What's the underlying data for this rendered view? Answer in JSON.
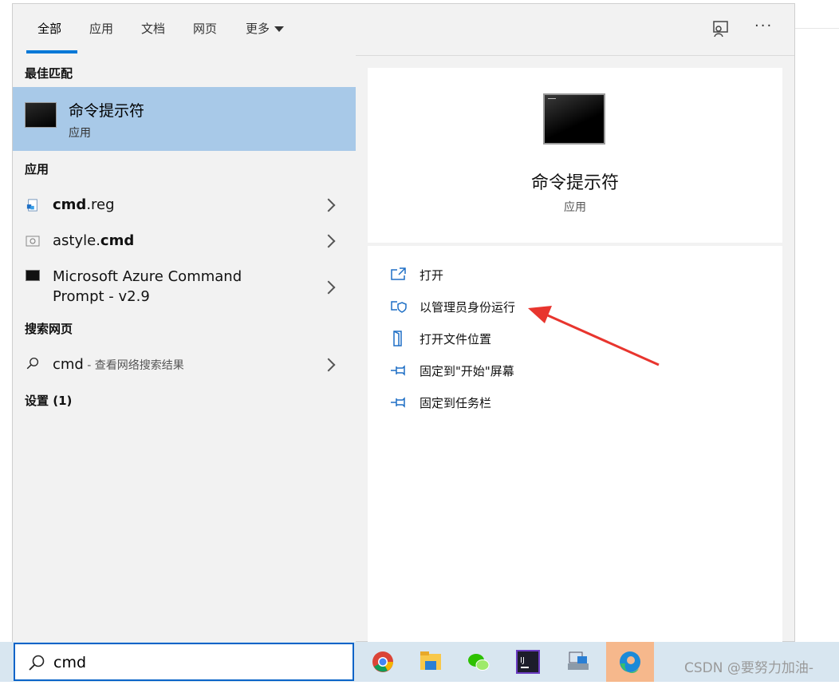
{
  "tabs": [
    {
      "label": "全部",
      "active": true
    },
    {
      "label": "应用"
    },
    {
      "label": "文档"
    },
    {
      "label": "网页"
    },
    {
      "label": "更多"
    }
  ],
  "toolbar_icons": [
    "feedback-icon",
    "more-options-icon"
  ],
  "more_dots": "···",
  "best_match": {
    "section": "最佳匹配",
    "title": "命令提示符",
    "subtitle": "应用",
    "icon": "command-prompt-icon"
  },
  "apps": {
    "section": "应用",
    "items": [
      {
        "bold": "cmd",
        "rest": ".reg",
        "icon": "registry-file-icon"
      },
      {
        "pre": "astyle.",
        "bold": "cmd",
        "icon": "cmd-file-icon"
      },
      {
        "line1": "Microsoft Azure Command",
        "line2": "Prompt - v2.9",
        "icon": "terminal-icon"
      }
    ]
  },
  "web": {
    "section": "搜索网页",
    "query": "cmd",
    "hint": " - 查看网络搜索结果",
    "icon": "search-icon"
  },
  "settings": {
    "section": "设置 (1)"
  },
  "detail": {
    "title": "命令提示符",
    "subtitle": "应用",
    "actions": [
      {
        "label": "打开",
        "icon": "open-icon"
      },
      {
        "label": "以管理员身份运行",
        "icon": "shield-icon"
      },
      {
        "label": "打开文件位置",
        "icon": "file-location-icon"
      },
      {
        "label": "固定到\"开始\"屏幕",
        "icon": "pin-icon"
      },
      {
        "label": "固定到任务栏",
        "icon": "pin-icon"
      }
    ]
  },
  "annotation": {
    "color": "#e8352e",
    "points_to": "以管理员身份运行"
  },
  "taskbar": {
    "search_value": "cmd",
    "apps": [
      "chrome-icon",
      "file-explorer-icon",
      "wechat-icon",
      "intellij-icon",
      "network-tool-icon",
      "edge-icon"
    ],
    "active_app": "edge-icon"
  },
  "watermark": "CSDN @要努力加油-",
  "accent_color": "#0078d7",
  "selection_color": "#a8c9e8"
}
